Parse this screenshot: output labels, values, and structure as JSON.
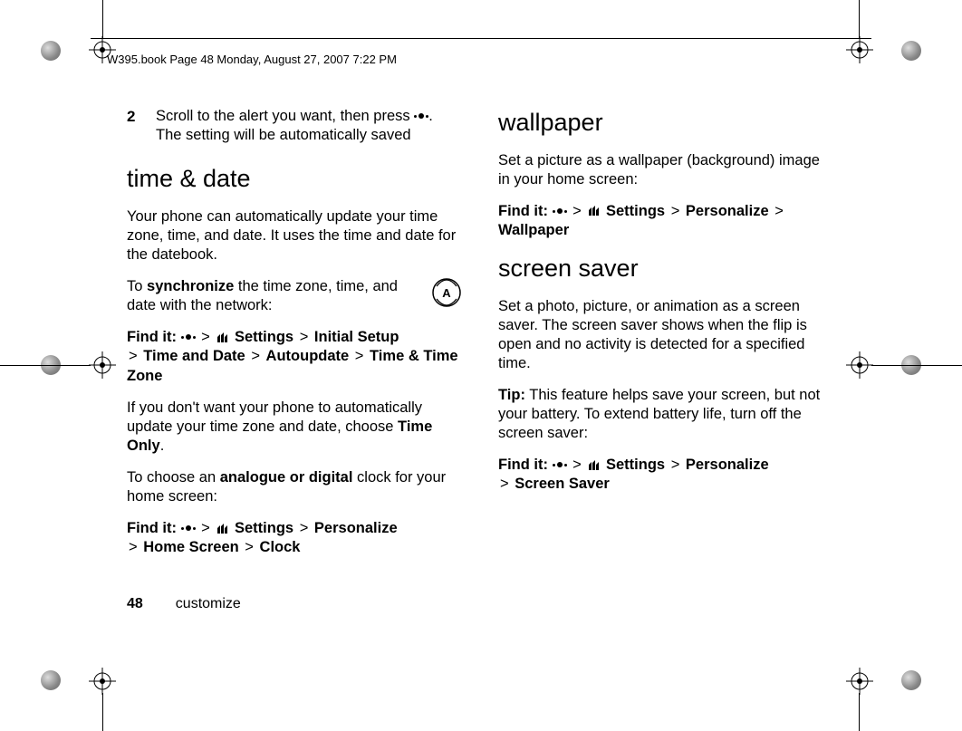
{
  "header": "W395.book  Page 48  Monday, August 27, 2007  7:22 PM",
  "left": {
    "step_num": "2",
    "step_text_a": "Scroll to the alert you want, then press ",
    "step_text_b": ". The setting will be automatically saved",
    "h_time": "time & date",
    "p1": "Your phone can automatically update your time zone, time, and date. It uses the time and date for the datebook.",
    "p2a": "To ",
    "p2b": "synchronize",
    "p2c": " the time zone, time, and date with the network:",
    "fi": "Find it:",
    "nav1_settings": "Settings",
    "nav1_initial": "Initial Setup",
    "nav1_td": "Time and Date",
    "nav1_auto": "Autoupdate",
    "nav1_ttz": "Time & Time Zone",
    "p3a": "If you don't want your phone to automatically update your time zone and date, choose ",
    "p3b": "Time Only",
    "p3c": ".",
    "p4a": "To choose an ",
    "p4b": "analogue or digital",
    "p4c": " clock for your home screen:",
    "nav2_settings": "Settings",
    "nav2_pers": "Personalize",
    "nav2_home": "Home Screen",
    "nav2_clock": "Clock"
  },
  "right": {
    "h_wall": "wallpaper",
    "p_wall": "Set a picture as a wallpaper (background) image in your home screen:",
    "fi": "Find it:",
    "navw_settings": "Settings",
    "navw_pers": "Personalize",
    "navw_wall": "Wallpaper",
    "h_ss": "screen saver",
    "p_ss1": "Set a photo, picture, or animation as a screen saver. The screen saver shows when the flip is open and no activity is detected for a specified time.",
    "tip": "Tip:",
    "p_ss2": " This feature helps save your screen, but not your battery. To extend battery life, turn off the screen saver:",
    "navs_settings": "Settings",
    "navs_pers": "Personalize",
    "navs_ss": "Screen Saver"
  },
  "footer": {
    "page": "48",
    "section": "customize"
  },
  "gt": ">"
}
